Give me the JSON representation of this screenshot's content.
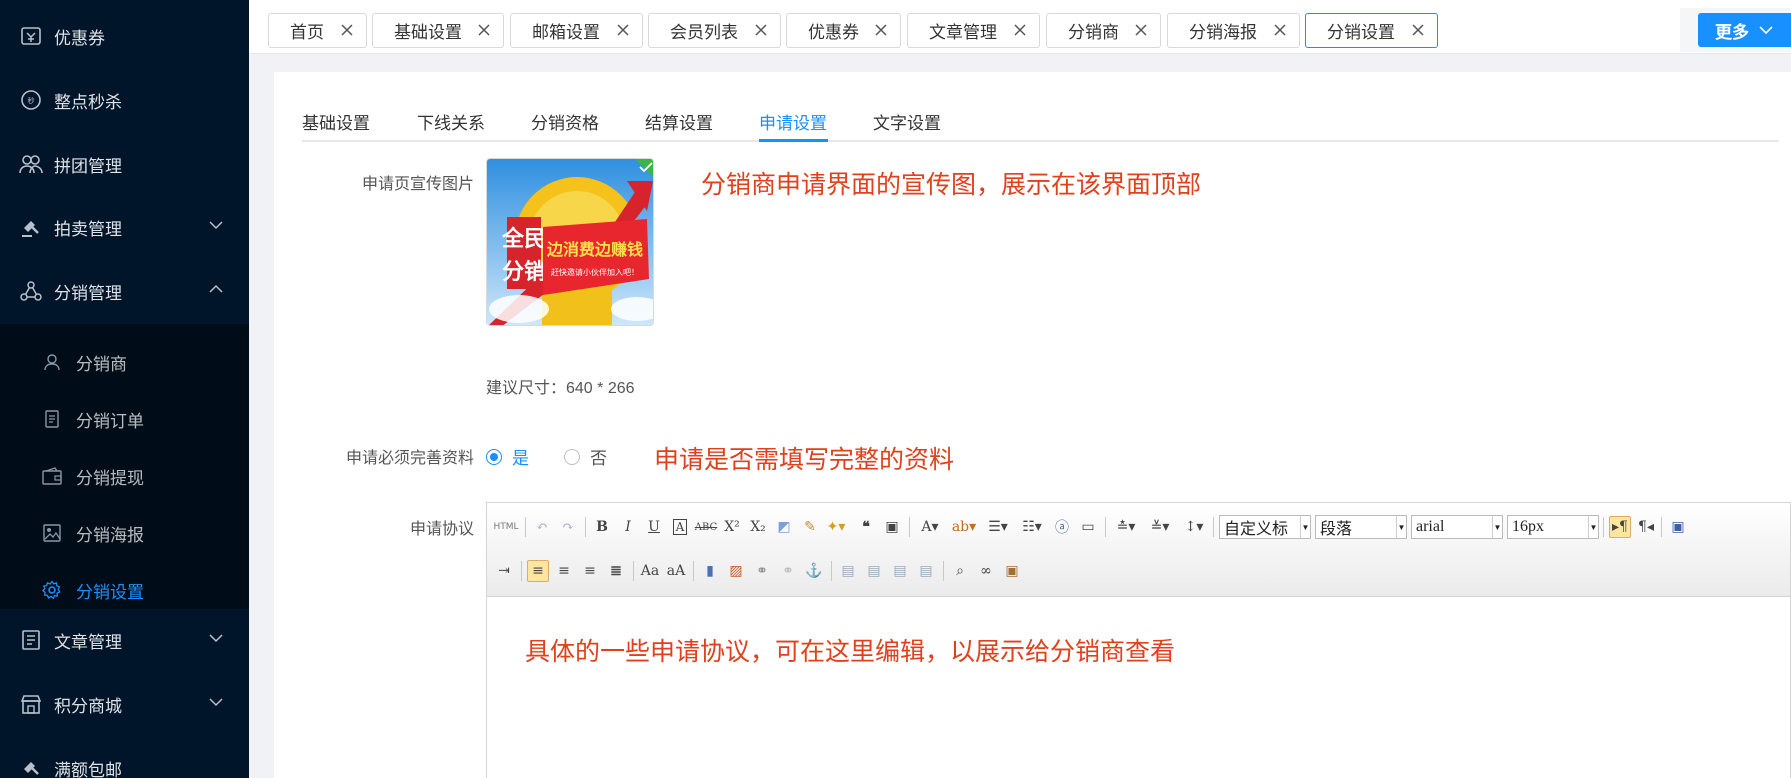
{
  "sidebar": {
    "items": [
      {
        "label": "优惠券",
        "icon": "coupon-icon"
      },
      {
        "label": "整点秒杀",
        "icon": "flash-sale-icon"
      },
      {
        "label": "拼团管理",
        "icon": "group-buy-icon"
      },
      {
        "label": "拍卖管理",
        "icon": "auction-icon"
      },
      {
        "label": "分销管理",
        "icon": "distribution-icon"
      },
      {
        "label": "文章管理",
        "icon": "article-icon"
      },
      {
        "label": "积分商城",
        "icon": "points-mall-icon"
      },
      {
        "label": "满额包邮",
        "icon": "free-shipping-icon"
      }
    ],
    "subitems": [
      {
        "label": "分销商",
        "icon": "user-icon"
      },
      {
        "label": "分销订单",
        "icon": "order-icon"
      },
      {
        "label": "分销提现",
        "icon": "wallet-icon"
      },
      {
        "label": "分销海报",
        "icon": "poster-icon"
      },
      {
        "label": "分销设置",
        "icon": "gear-icon"
      }
    ]
  },
  "tabs": [
    "首页",
    "基础设置",
    "邮箱设置",
    "会员列表",
    "优惠券",
    "文章管理",
    "分销商",
    "分销海报",
    "分销设置"
  ],
  "active_tab": "分销设置",
  "more_label": "更多",
  "subtabs": [
    "基础设置",
    "下线关系",
    "分销资格",
    "结算设置",
    "申请设置",
    "文字设置"
  ],
  "active_subtab": "申请设置",
  "form": {
    "image_label": "申请页宣传图片",
    "image_note": "分销商申请界面的宣传图，展示在该界面顶部",
    "image_text": {
      "big1": "全民",
      "big2": "分销",
      "banner": "边消费边赚钱",
      "sub": "赶快邀请小伙伴加入吧！"
    },
    "size_hint": "建议尺寸：640 * 266",
    "required_label": "申请必须完善资料",
    "yes": "是",
    "no": "否",
    "required_value": "是",
    "required_note": "申请是否需填写完整的资料",
    "agreement_label": "申请协议",
    "agreement_body": "具体的一些申请协议，可在这里编辑，以展示给分销商查看"
  },
  "editor": {
    "html_label": "HTML",
    "custom_style": "自定义标",
    "paragraph": "段落",
    "font": "arial",
    "size": "16px"
  },
  "colors": {
    "accent": "#1890ff",
    "sidebar": "#001529",
    "note": "#e0401c"
  }
}
